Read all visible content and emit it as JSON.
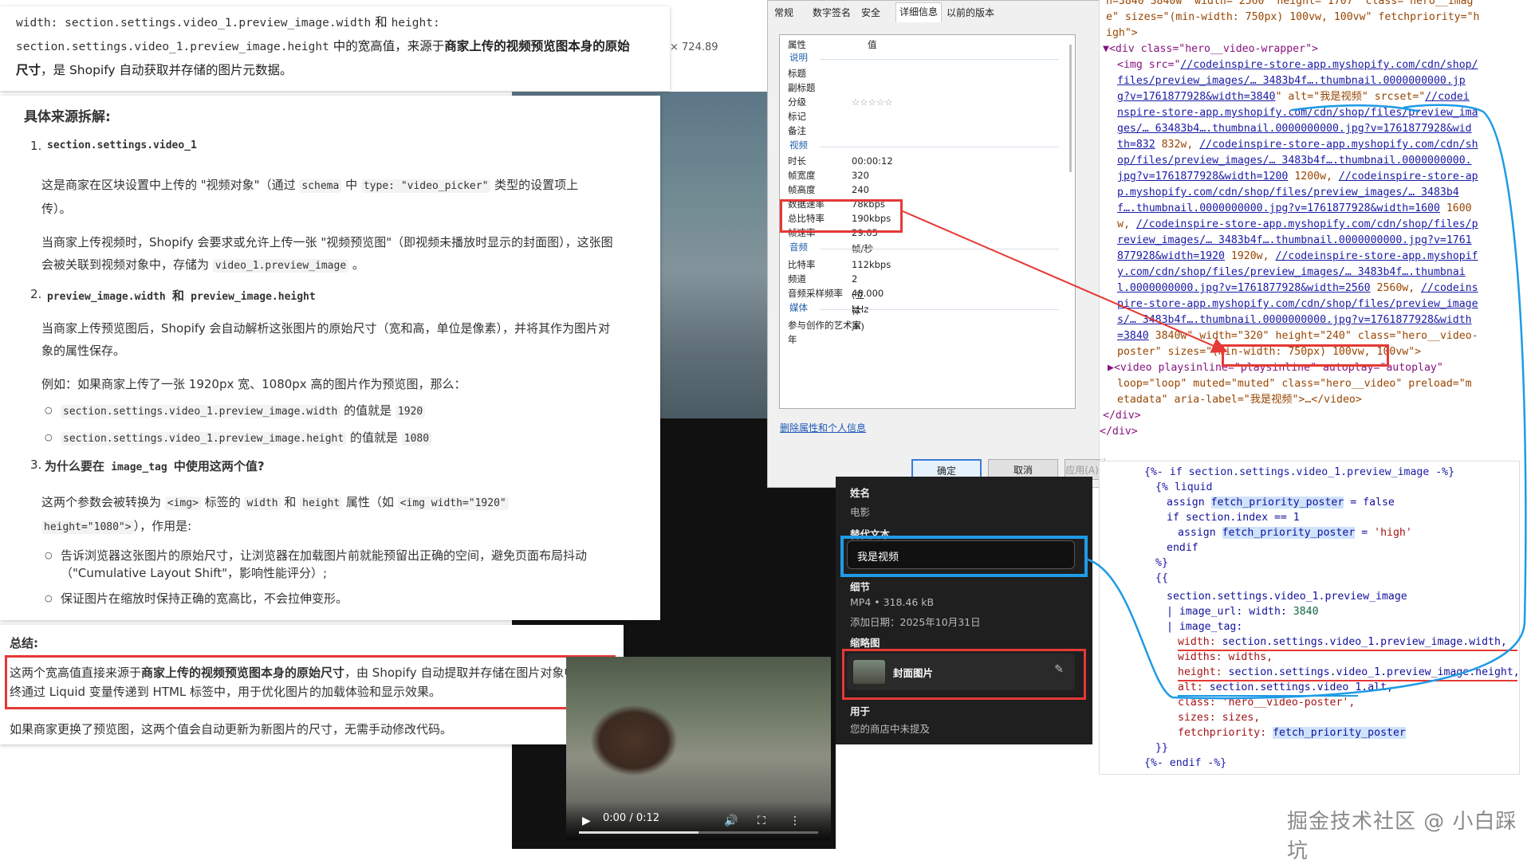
{
  "excerpt": {
    "line1_code": "width: section.settings.video_1.preview_image.width",
    "line1_and": " 和 ",
    "line1_code2": "height:",
    "line2_code": "section.settings.video_1.preview_image.height",
    "line2_text": " 中的宽高值，来源于",
    "line2_bold": "商家上传的视频预览图本身的原始",
    "line3_bold": "尺寸",
    "line3_text": "，是 Shopify 自动获取并存储的图片元数据。"
  },
  "bg": {
    "resolution": "× 724.89"
  },
  "article": {
    "heading": "具体来源拆解:",
    "item1": {
      "num": "1.",
      "title": "section.settings.video_1",
      "p1_a": "这是商家在区块设置中上传的 \"视频对象\"（通过 ",
      "p1_code1": "schema",
      "p1_b": " 中 ",
      "p1_code2": "type: \"video_picker\"",
      "p1_c": " 类型的设置项上",
      "p1_d": "传）。",
      "p2_a": "当商家上传视频时，Shopify 会要求或允许上传一张 \"视频预览图\"（即视频未播放时显示的封面图），这张图",
      "p2_b": "会被关联到视频对象中，存储为 ",
      "p2_code": "video_1.preview_image",
      "p2_c": " 。"
    },
    "item2": {
      "num": "2.",
      "title_code1": "preview_image.width",
      "title_and": " 和 ",
      "title_code2": "preview_image.height",
      "p1_a": "当商家上传预览图后，Shopify 会自动解析这张图片的原始尺寸（宽和高，单位是像素），并将其作为图片对",
      "p1_b": "象的属性保存。",
      "p2": "例如：如果商家上传了一张 1920px 宽、1080px 高的图片作为预览图，那么：",
      "b1_code": "section.settings.video_1.preview_image.width",
      "b1_text": " 的值就是 ",
      "b1_val": "1920",
      "b2_code": "section.settings.video_1.preview_image.height",
      "b2_text": " 的值就是 ",
      "b2_val": "1080"
    },
    "item3": {
      "num": "3.",
      "title_a": "为什么要在 ",
      "title_code": "image_tag",
      "title_b": " 中使用这两个值?",
      "p1_a": "这两个参数会被转换为 ",
      "p1_code1": "<img>",
      "p1_b": " 标签的 ",
      "p1_code2": "width",
      "p1_c": " 和 ",
      "p1_code3": "height",
      "p1_d": " 属性（如 ",
      "p1_code4": "<img width=\"1920\"",
      "p1_code5": "height=\"1080\">",
      "p1_e": "），作用是:",
      "b1_a": "告诉浏览器这张图片的原始尺寸，让浏览器在加载图片前就能预留出正确的空间，避免页面布局抖动",
      "b1_b": "（\"Cumulative Layout Shift\"，影响性能评分）;",
      "b2": "保证图片在缩放时保持正确的宽高比，不会拉伸变形。"
    }
  },
  "summary": {
    "title": "总结:",
    "l1_a": "这两个宽高值直接来源于",
    "l1_bold": "商家上传的视频预览图本身的原始尺寸",
    "l1_b": "，由 Shopify 自动提取并存储在图片对象中，最",
    "l2": "终通过 Liquid 变量传递到 HTML 标签中，用于优化图片的加载体验和显示效果。",
    "l3": "如果商家更换了预览图，这两个值会自动更新为新图片的尺寸，无需手动修改代码。"
  },
  "dialog": {
    "tabs": [
      "常规",
      "数字签名",
      "安全",
      "详细信息",
      "以前的版本"
    ],
    "col_prop": "属性",
    "col_val": "值",
    "sec_desc": "说明",
    "rows_desc": [
      "标题",
      "副标题",
      "分级",
      "标记",
      "备注"
    ],
    "rating": "☆☆☆☆☆",
    "sec_video": "视频",
    "duration_label": "时长",
    "duration": "00:00:12",
    "width_label": "帧宽度",
    "width": "320",
    "height_label": "帧高度",
    "height": "240",
    "datarate_label": "数据速率",
    "datarate": "78kbps",
    "bitrate_label": "总比特率",
    "bitrate": "190kbps",
    "fps_label": "帧速率",
    "fps": "29.65 帧/秒",
    "sec_audio": "音频",
    "abitrate_label": "比特率",
    "abitrate": "112kbps",
    "channels_label": "频道",
    "channels": "2 (立体声)",
    "sample_label": "音频采样频率",
    "sample": "48.000 kHz",
    "sec_media": "媒体",
    "artist_label": "参与创作的艺术家",
    "year_label": "年",
    "remove_link": "删除属性和个人信息",
    "ok": "确定",
    "cancel": "取消",
    "apply": "应用(A)"
  },
  "shop": {
    "name_label": "姓名",
    "name_value": "电影",
    "alt_label": "替代文本",
    "alt_value": "我是视频",
    "detail_label": "细节",
    "detail_value": "MP4 • 318.46 kB",
    "added": "添加日期：2025年10月31日",
    "thumb_label": "缩略图",
    "thumb_value": "封面图片",
    "used_label": "用于",
    "used_value": "您的商店中未提及"
  },
  "video": {
    "time": "0:00 / 0:12",
    "progress": 0.5
  },
  "devtools": {
    "l0": "n=3840 3840w\" width=\"2560\" height=\"1707\" class=\"hero__imag",
    "l1": "e\" sizes=\"(min-width: 750px) 100vw, 100vw\" fetchpriority=\"h",
    "l2": "igh\">",
    "l3": "▼<div class=\"hero__video-wrapper\">",
    "l4a": "<img src=\"",
    "l4b": "//codeinspire-store-app.myshopify.com/cdn/shop/",
    "l5": "files/preview_images/… 3483b4f….thumbnail.0000000000.jp",
    "l6a": "g?v=1761877928&width=3840",
    "l6b": "\" alt=\"我是视频\" srcset=\"",
    "l6c": "//codei",
    "l7": "nspire-store-app.myshopify.com/cdn/shop/files/preview_ima",
    "l8": "ges/… 63483b4….thumbnail.0000000000.jpg?v=1761877928&wid",
    "l9a": "th=832",
    "l9b": " 832w, ",
    "l9c": "//codeinspire-store-app.myshopify.com/cdn/sh",
    "l10": "op/files/preview_images/… 3483b4f….thumbnail.0000000000.",
    "l11a": "jpg?v=1761877928&width=1200",
    "l11b": " 1200w, ",
    "l11c": "//codeinspire-store-ap",
    "l12": "p.myshopify.com/cdn/shop/files/preview_images/… 3483b4",
    "l13a": "f….thumbnail.0000000000.jpg?v=1761877928&width=1600",
    "l13b": " 1600",
    "l14a": "w, ",
    "l14b": "//codeinspire-store-app.myshopify.com/cdn/shop/files/p",
    "l15": "review_images/… 3483b4f….thumbnail.0000000000.jpg?v=1761",
    "l16a": "877928&width=1920",
    "l16b": " 1920w, ",
    "l16c": "//codeinspire-store-app.myshopif",
    "l17": "y.com/cdn/shop/files/preview_images/… 3483b4f….thumbnai",
    "l18a": "l.0000000000.jpg?v=1761877928&width=2560",
    "l18b": " 2560w, ",
    "l18c": "//codeins",
    "l19": "pire-store-app.myshopify.com/cdn/shop/files/preview_image",
    "l20": "s/… 3483b4f….thumbnail.0000000000.jpg?v=1761877928&width",
    "l21a": "=3840",
    "l21b": " 3840w\" ",
    "l21c": "width=\"320\" height=\"240\"",
    "l21d": " class=\"hero__video-",
    "l22": "poster\" sizes=\"(min-width: 750px) 100vw, 100vw\">",
    "l23": "▶<video playsinline=\"playsinline\" autoplay=\"autoplay\"",
    "l24": "loop=\"loop\" muted=\"muted\" class=\"hero__video\" preload=\"m",
    "l25": "etadata\" aria-label=\"我是视频\">…</video>",
    "l26": "</div>",
    "l27": "</div>"
  },
  "liquid": {
    "l0": "{%- if section.settings.video_1.preview_image -%}",
    "l1": "{% liquid",
    "l2a": "assign ",
    "l2b": "fetch_priority_poster",
    "l2c": " = false",
    "l3": "if section.index == 1",
    "l4a": "assign ",
    "l4b": "fetch_priority_poster",
    "l4c": " = ",
    "l4d": "'high'",
    "l5": "endif",
    "l6": "%}",
    "l7": "{{",
    "l8": "section.settings.video_1.preview_image",
    "l9a": "| image_url: width: ",
    "l9b": "3840",
    "l10": "| image_tag:",
    "l11a": "width: ",
    "l11b": "section.settings.video_1.preview_image.width,",
    "l12": "widths: widths,",
    "l13a": "height: ",
    "l13b": "section.settings.video_1.preview_image.height,",
    "l14a": "alt: ",
    "l14b": "section.settings.video_1.alt,",
    "l15": "class: 'hero__video-poster',",
    "l16": "sizes: sizes,",
    "l17a": "fetchpriority: ",
    "l17b": "fetch_priority_poster",
    "l18": "}}",
    "l19": "{%- endif -%}"
  },
  "watermark": "掘金技术社区 @ 小白踩坑",
  "colors": {
    "annotation_red": "#e53935",
    "annotation_blue": "#1e9be6"
  }
}
